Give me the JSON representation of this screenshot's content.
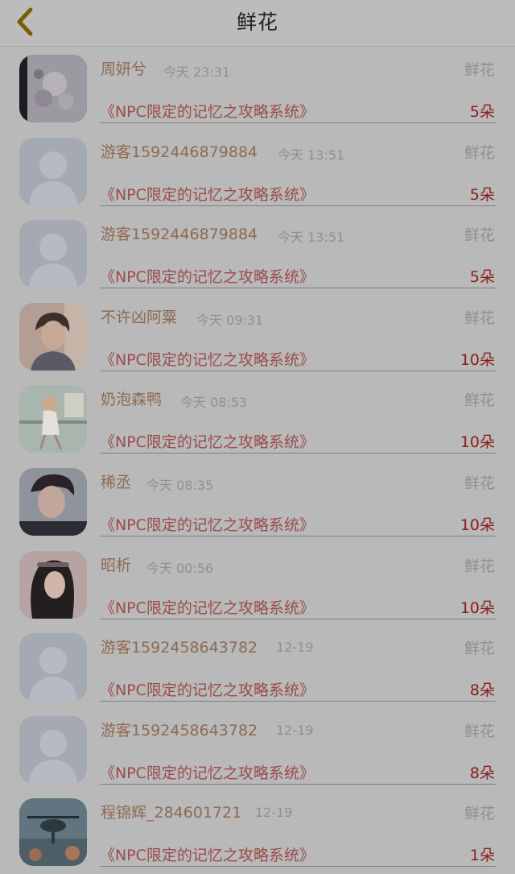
{
  "header": {
    "title": "鲜花",
    "back_icon": "chevron-left-icon",
    "accent_color": "#8c6c00"
  },
  "rows": [
    {
      "name": "周妍兮",
      "time": "今天 23:31",
      "type": "鲜花",
      "book": "《NPC限定的记忆之攻略系统》",
      "count": "5朵",
      "avatar": "photo-flowers"
    },
    {
      "name": "游客1592446879884",
      "time": "今天 13:51",
      "type": "鲜花",
      "book": "《NPC限定的记忆之攻略系统》",
      "count": "5朵",
      "avatar": "default-person"
    },
    {
      "name": "游客1592446879884",
      "time": "今天 13:51",
      "type": "鲜花",
      "book": "《NPC限定的记忆之攻略系统》",
      "count": "5朵",
      "avatar": "default-person"
    },
    {
      "name": "不许凶阿粟",
      "time": "今天 09:31",
      "type": "鲜花",
      "book": "《NPC限定的记忆之攻略系统》",
      "count": "10朵",
      "avatar": "photo-boy"
    },
    {
      "name": "奶泡森鸭",
      "time": "今天 08:53",
      "type": "鲜花",
      "book": "《NPC限定的记忆之攻略系统》",
      "count": "10朵",
      "avatar": "illustration-girl"
    },
    {
      "name": "稀丞",
      "time": "今天 08:35",
      "type": "鲜花",
      "book": "《NPC限定的记忆之攻略系统》",
      "count": "10朵",
      "avatar": "photo-man"
    },
    {
      "name": "昭析",
      "time": "今天 00:56",
      "type": "鲜花",
      "book": "《NPC限定的记忆之攻略系统》",
      "count": "10朵",
      "avatar": "photo-woman"
    },
    {
      "name": "游客1592458643782",
      "time": "12-19",
      "type": "鲜花",
      "book": "《NPC限定的记忆之攻略系统》",
      "count": "8朵",
      "avatar": "default-person"
    },
    {
      "name": "游客1592458643782",
      "time": "12-19",
      "type": "鲜花",
      "book": "《NPC限定的记忆之攻略系统》",
      "count": "8朵",
      "avatar": "default-person"
    },
    {
      "name": "程锦辉_284601721",
      "time": "12-19",
      "type": "鲜花",
      "book": "《NPC限定的记忆之攻略系统》",
      "count": "1朵",
      "avatar": "illustration-helicopter"
    }
  ]
}
